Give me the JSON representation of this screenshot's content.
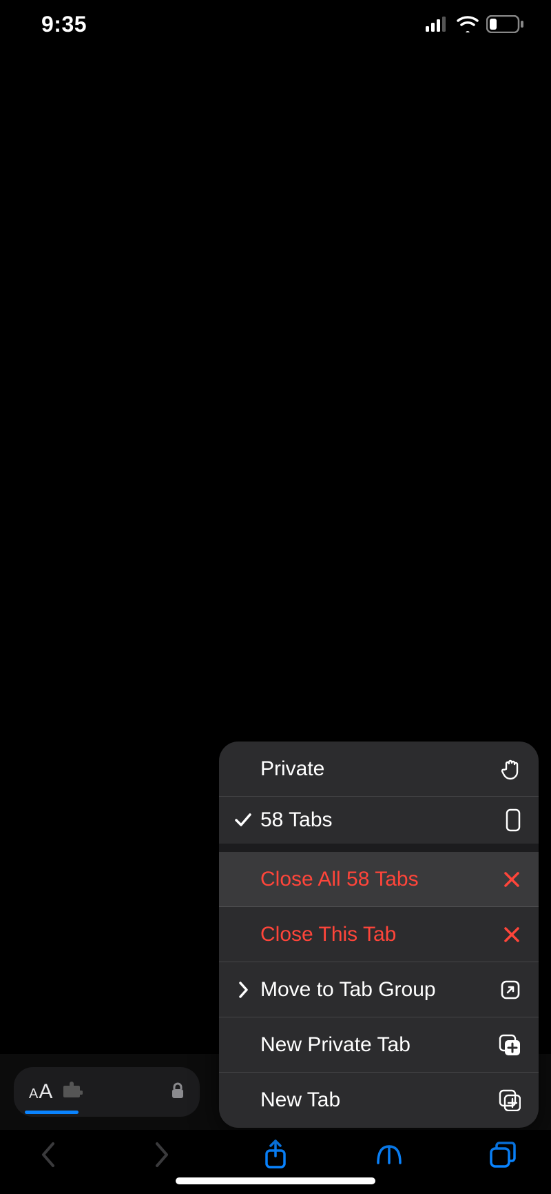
{
  "status": {
    "time": "9:35"
  },
  "menu": {
    "private": "Private",
    "tabs_label": "58 Tabs",
    "close_all": "Close All 58 Tabs",
    "close_this": "Close This Tab",
    "move_group": "Move to Tab Group",
    "new_private": "New Private Tab",
    "new_tab": "New Tab"
  }
}
